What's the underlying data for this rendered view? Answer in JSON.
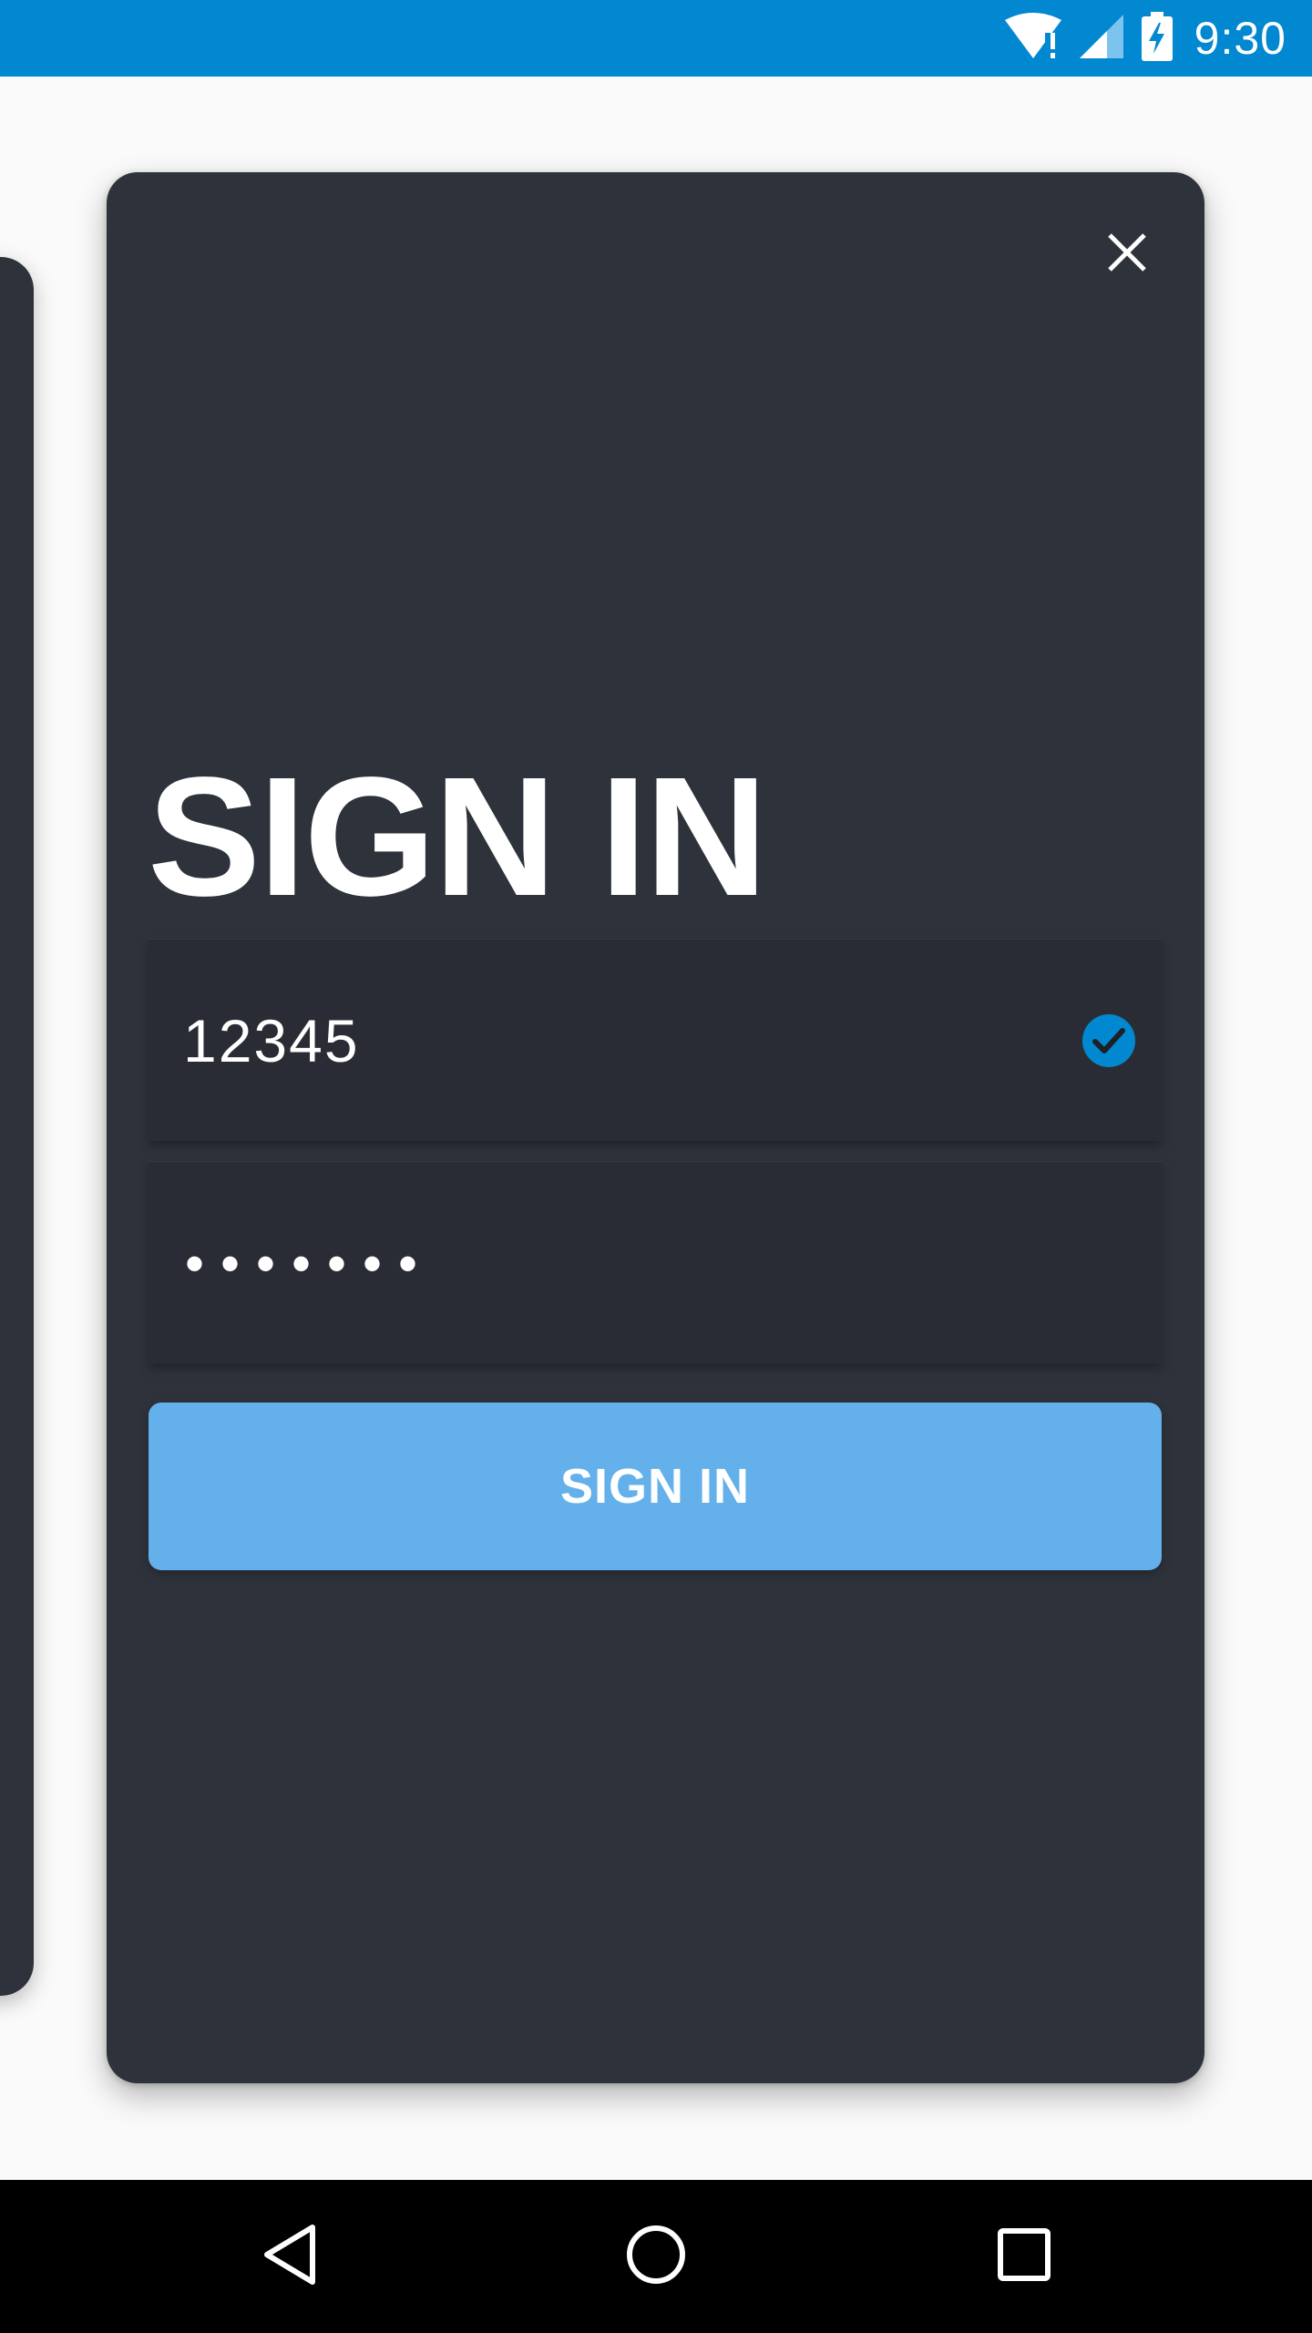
{
  "status_bar": {
    "time": "9:30",
    "icons": [
      "wifi-alert-icon",
      "cell-signal-icon",
      "battery-charging-icon"
    ],
    "color": "#0288d1"
  },
  "sign_in_card": {
    "close_icon": "close-icon",
    "title": "SIGN IN",
    "username": {
      "value": "12345",
      "status_icon": "check-circle-icon",
      "status_color": "#0288d1"
    },
    "password": {
      "value": "1234567"
    },
    "submit_label": "SIGN IN",
    "submit_color": "#63b0ea",
    "card_color": "#2e323b"
  },
  "nav_bar": {
    "buttons": [
      "back-icon",
      "home-icon",
      "recents-icon"
    ]
  }
}
